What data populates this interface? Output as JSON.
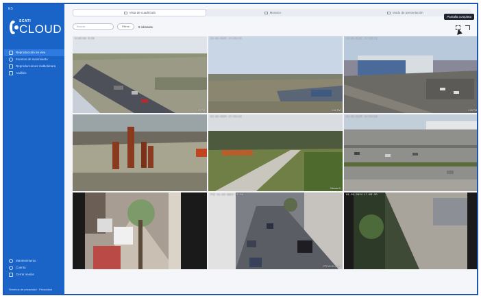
{
  "sidebar": {
    "lang": "ES",
    "logo_small": "SCATI",
    "logo_big": "CLOUD",
    "nav": [
      {
        "label": "Reproducción en vivo",
        "icon": "live-icon"
      },
      {
        "label": "Eventos de movimiento",
        "icon": "motion-icon"
      },
      {
        "label": "Reproducciones multicámara",
        "icon": "playback-icon"
      },
      {
        "label": "Análisis",
        "icon": "analytics-icon"
      }
    ],
    "bottom": [
      {
        "label": "Mantenimiento",
        "icon": "settings-icon"
      },
      {
        "label": "Cuenta",
        "icon": "user-icon"
      },
      {
        "label": "Cerrar sesión",
        "icon": "logout-icon"
      }
    ],
    "footer": "Términos de privacidad · Privacidad"
  },
  "tabs": [
    {
      "label": "Vista de cuadrícula",
      "active": true
    },
    {
      "label": "Mosaico",
      "active": false
    },
    {
      "label": "Modo de presentación",
      "active": false
    }
  ],
  "toolbar": {
    "search_placeholder": "Buscar",
    "filter_label": "Filtros",
    "count_label": "9 cámaras"
  },
  "fullscreen_tooltip": "Pantalla completa",
  "cameras": [
    {
      "stamp": "0:00:00 0:00",
      "label": "1:00 PM",
      "scene": "parking-road"
    },
    {
      "stamp": "01-02-2024 17:03:46",
      "label": "1:00 PM",
      "scene": "field"
    },
    {
      "stamp": "01-02-2024 17:03:18",
      "label": "1:00 PM",
      "scene": "warehouse"
    },
    {
      "stamp": "",
      "label": "",
      "scene": "sculpture"
    },
    {
      "stamp": "01-02-2024 17:03:52",
      "label": "Cámara 5",
      "scene": "rural-road"
    },
    {
      "stamp": "01-02-2024 17:02:36",
      "label": "",
      "scene": "car-park"
    },
    {
      "stamp": "",
      "label": "",
      "scene": "street-left"
    },
    {
      "stamp": "PTZ 01-02-2024 17:03",
      "label": "PTZ 01-02-2024",
      "scene": "street-center"
    },
    {
      "stamp": "01-02-2024 17:03:30",
      "label": "",
      "scene": "street-right"
    }
  ]
}
